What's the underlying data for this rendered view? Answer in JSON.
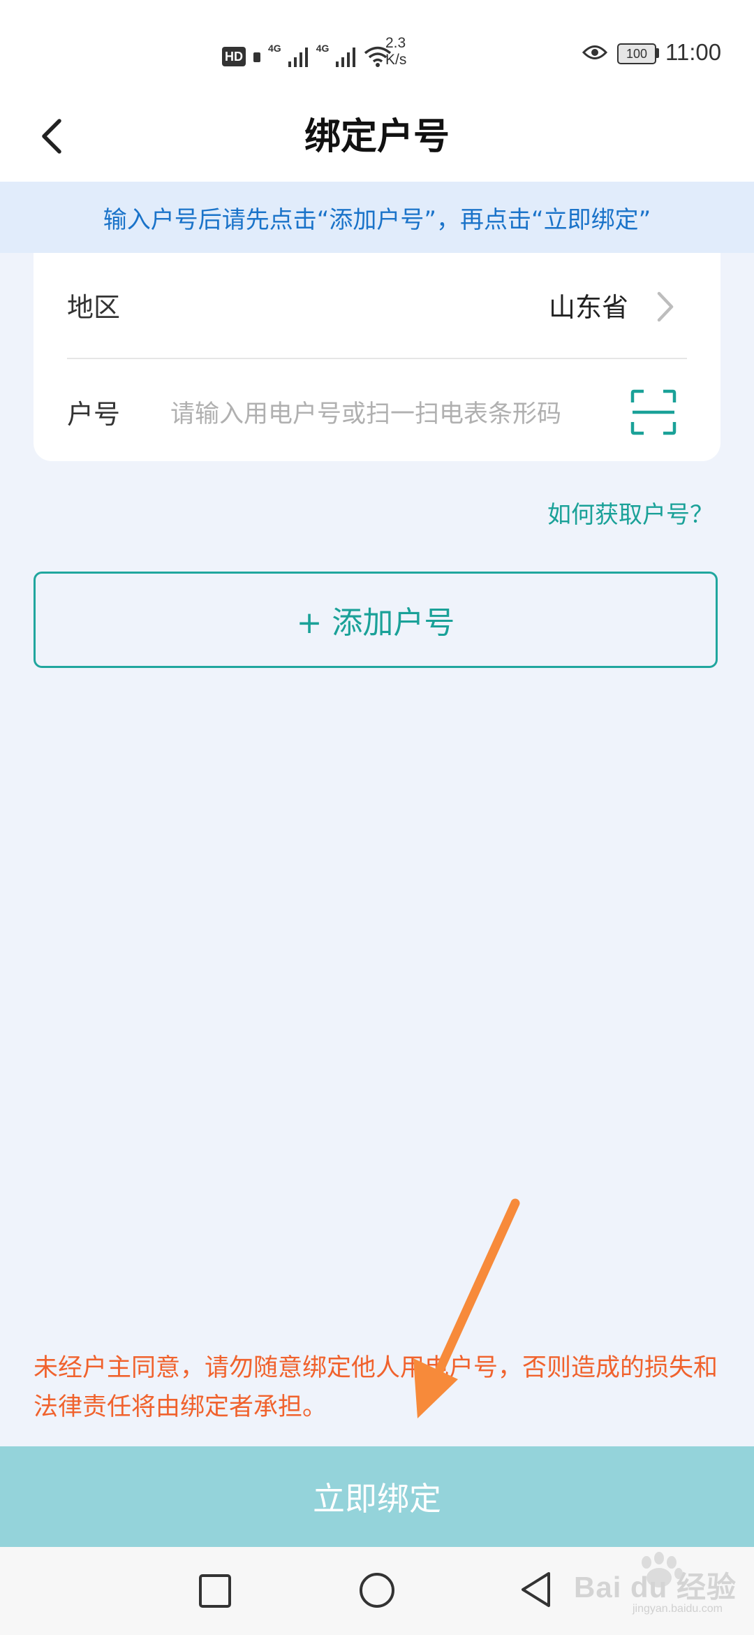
{
  "status_bar": {
    "hd_label": "HD",
    "signal_1_label": "4G",
    "signal_2_label": "4G",
    "speed_value": "2.3",
    "speed_unit": "K/s",
    "battery_level": "100",
    "time": "11:00"
  },
  "header": {
    "title": "绑定户号"
  },
  "notice": {
    "text": "输入户号后请先点击“添加户号”，再点击“立即绑定”"
  },
  "form": {
    "region_label": "地区",
    "region_value": "山东省",
    "account_label": "户号",
    "account_value": "",
    "account_placeholder": "请输入用电户号或扫一扫电表条形码"
  },
  "help_link": "如何获取户号？",
  "add_button_label": "+ 添加户号",
  "disclaimer": "未经户主同意，请勿随意绑定他人用电户号，否则造成的损失和法律责任将由绑定者承担。",
  "bind_button_label": "立即绑定",
  "watermark": {
    "text": "Bai du 经验",
    "sub": "jingyan.baidu.com"
  },
  "colors": {
    "accent": "#1aa198",
    "notice_text": "#1a73c9",
    "notice_bg": "#e1ecfb",
    "warning": "#f0622d",
    "bind_button_bg": "#94d3da",
    "page_bg": "#eff3fb",
    "annotation_arrow": "#f78a3a"
  },
  "icons": {
    "back": "chevron-left-icon",
    "region_chevron": "chevron-right-icon",
    "scan": "scan-icon",
    "nav_recent": "square-icon",
    "nav_home": "circle-icon",
    "nav_back": "triangle-icon"
  }
}
